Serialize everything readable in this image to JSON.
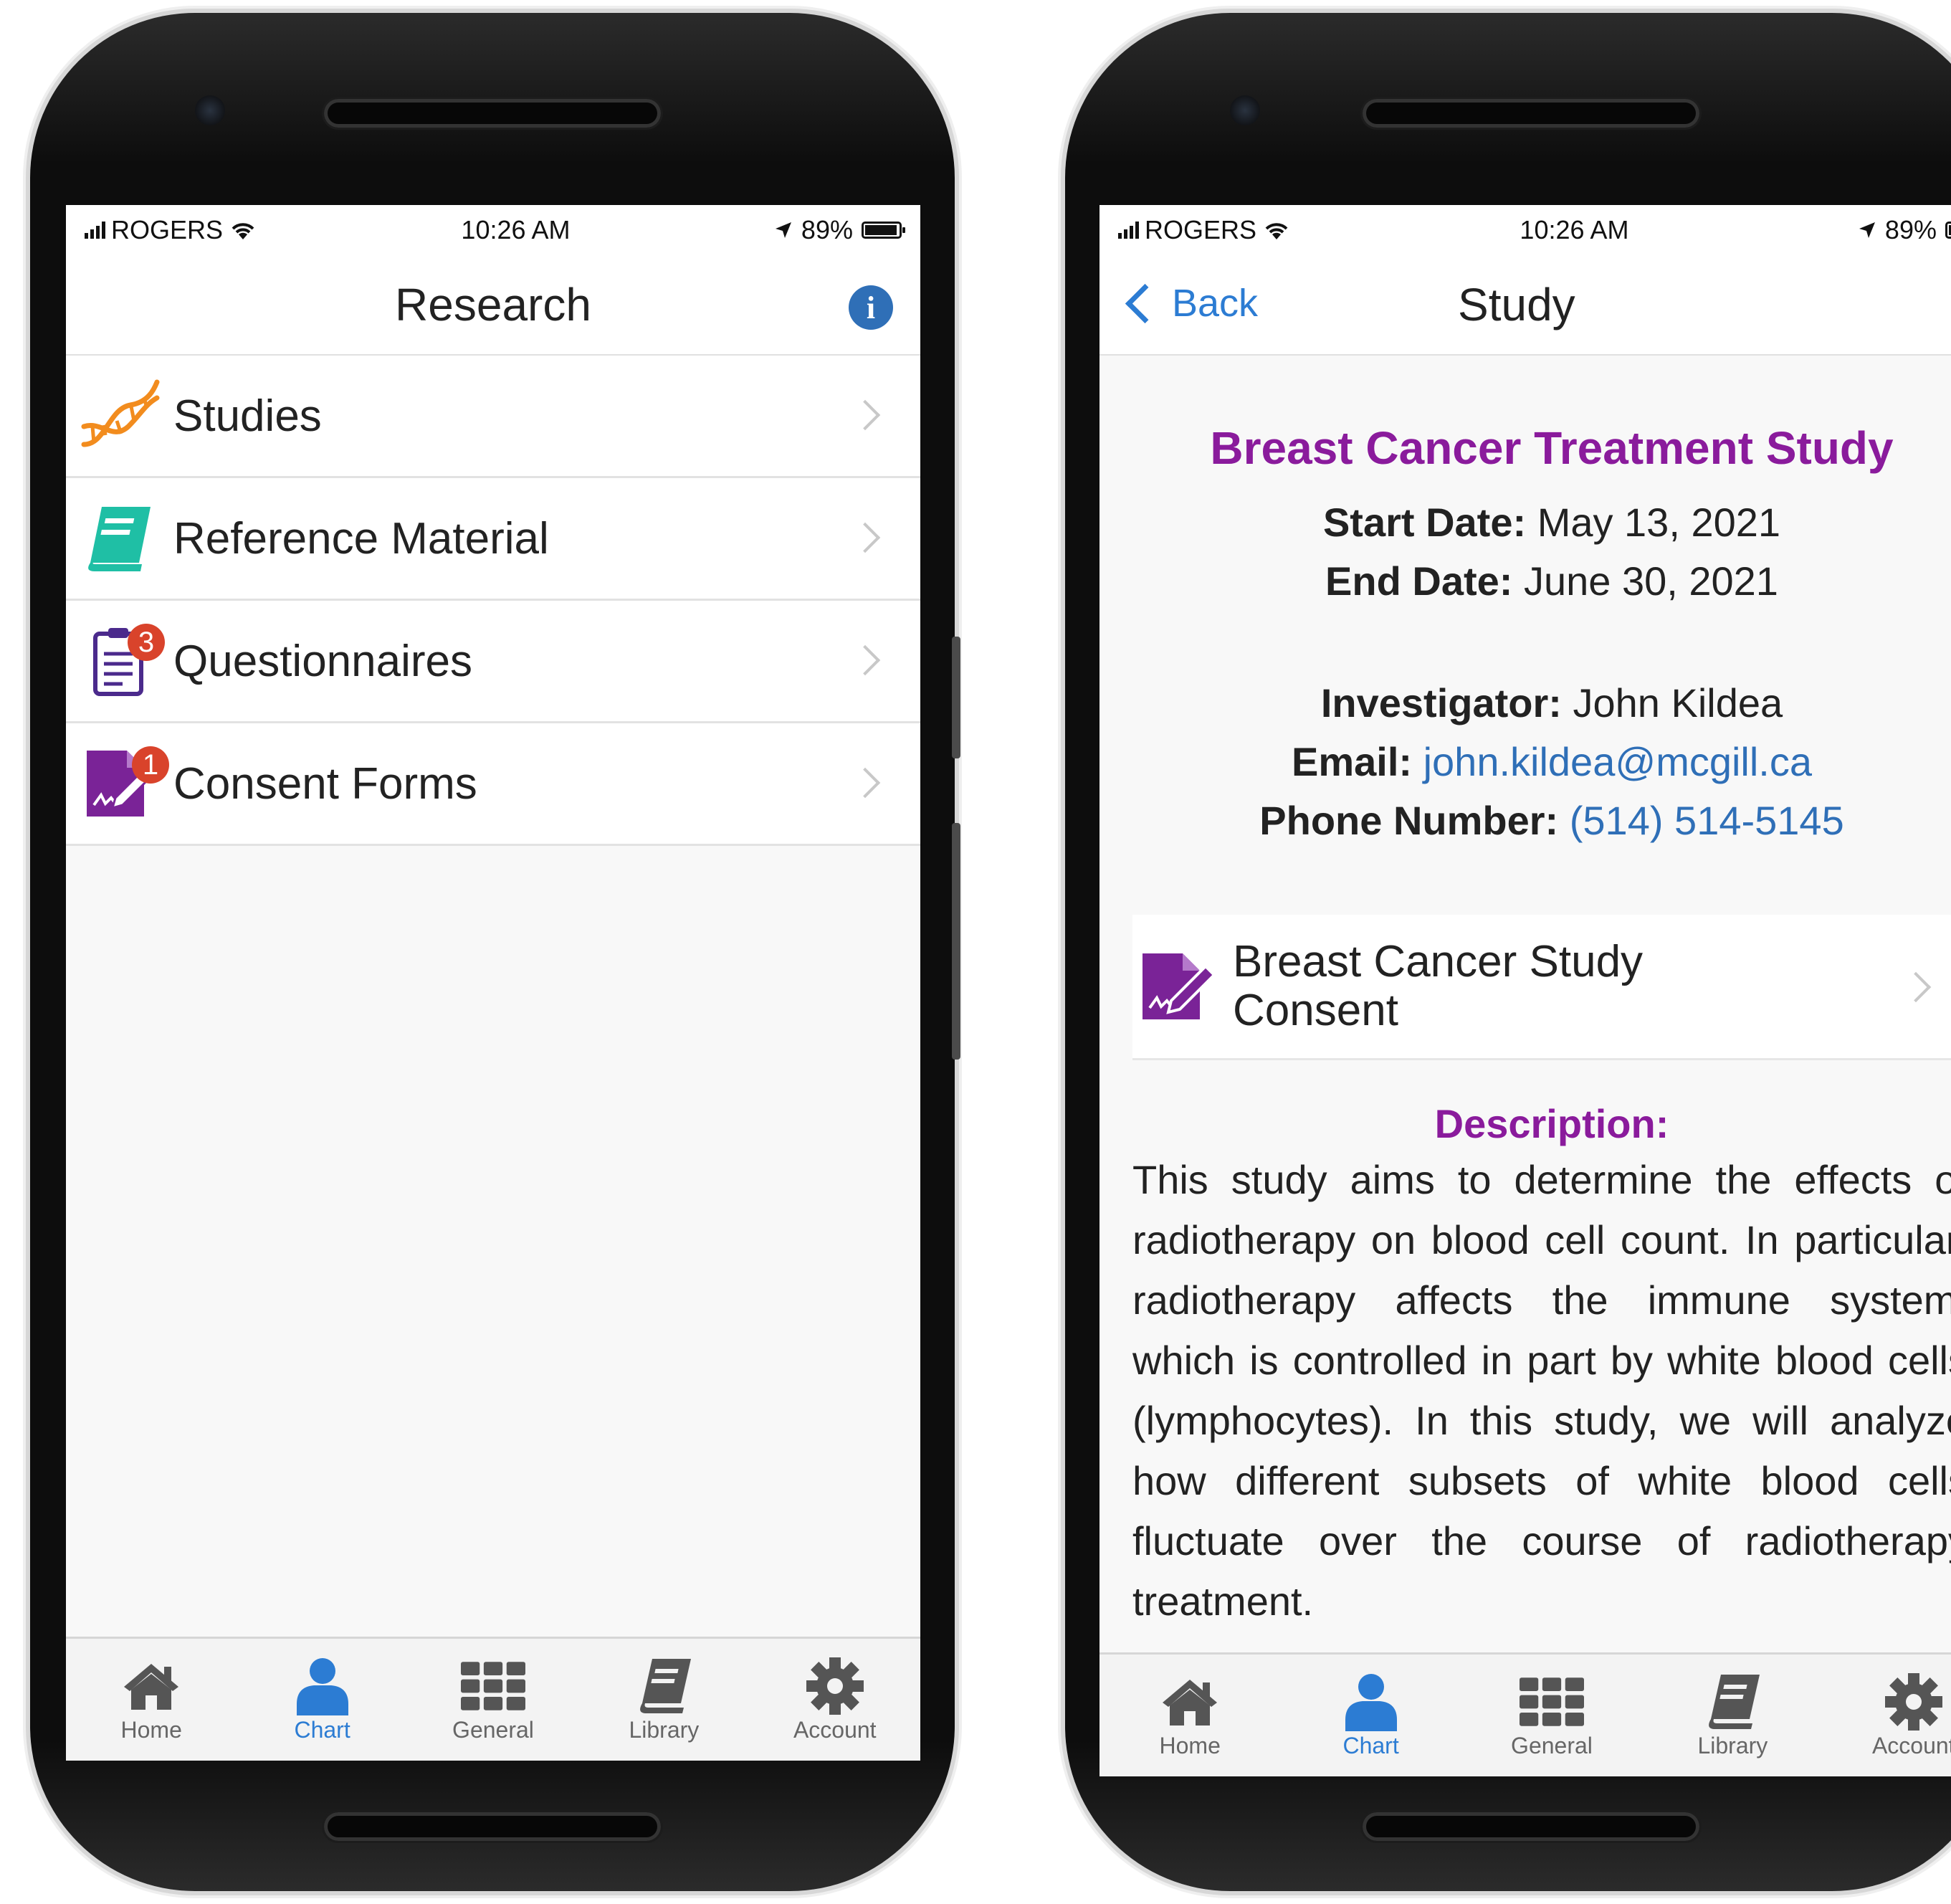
{
  "status": {
    "carrier": "ROGERS",
    "time": "10:26 AM",
    "battery": "89%"
  },
  "left": {
    "title": "Research",
    "items": [
      {
        "label": "Studies",
        "icon": "dna-icon"
      },
      {
        "label": "Reference Material",
        "icon": "book-icon"
      },
      {
        "label": "Questionnaires",
        "icon": "clipboard-icon",
        "badge": "3"
      },
      {
        "label": "Consent Forms",
        "icon": "signature-icon",
        "badge": "1"
      }
    ]
  },
  "right": {
    "back_label": "Back",
    "title": "Study",
    "study_title": "Breast Cancer Treatment Study",
    "start_label": "Start Date:",
    "start_value": "May 13, 2021",
    "end_label": "End Date:",
    "end_value": "June 30, 2021",
    "investigator_label": "Investigator:",
    "investigator_value": "John Kildea",
    "email_label": "Email:",
    "email_value": "john.kildea@mcgill.ca",
    "phone_label": "Phone Number:",
    "phone_value": "(514) 514-5145",
    "consent_label": "Breast Cancer Study Consent",
    "description_title": "Description:",
    "description_text": "This study aims to determine the effects of radiotherapy on blood cell count. In particular, radiotherapy affects the immune system, which is controlled in part by white blood cells (lymphocytes). In this study, we will analyze how different subsets of white blood cells fluctuate over the course of radiotherapy treatment."
  },
  "tabs": [
    {
      "label": "Home",
      "icon": "home-icon"
    },
    {
      "label": "Chart",
      "icon": "user-icon"
    },
    {
      "label": "General",
      "icon": "grid-icon"
    },
    {
      "label": "Library",
      "icon": "book-icon"
    },
    {
      "label": "Account",
      "icon": "gear-icon"
    }
  ],
  "colors": {
    "accent": "#2c7cd3",
    "purple": "#8a1b9c",
    "badge": "#d9432b",
    "link": "#2f6fb7"
  }
}
